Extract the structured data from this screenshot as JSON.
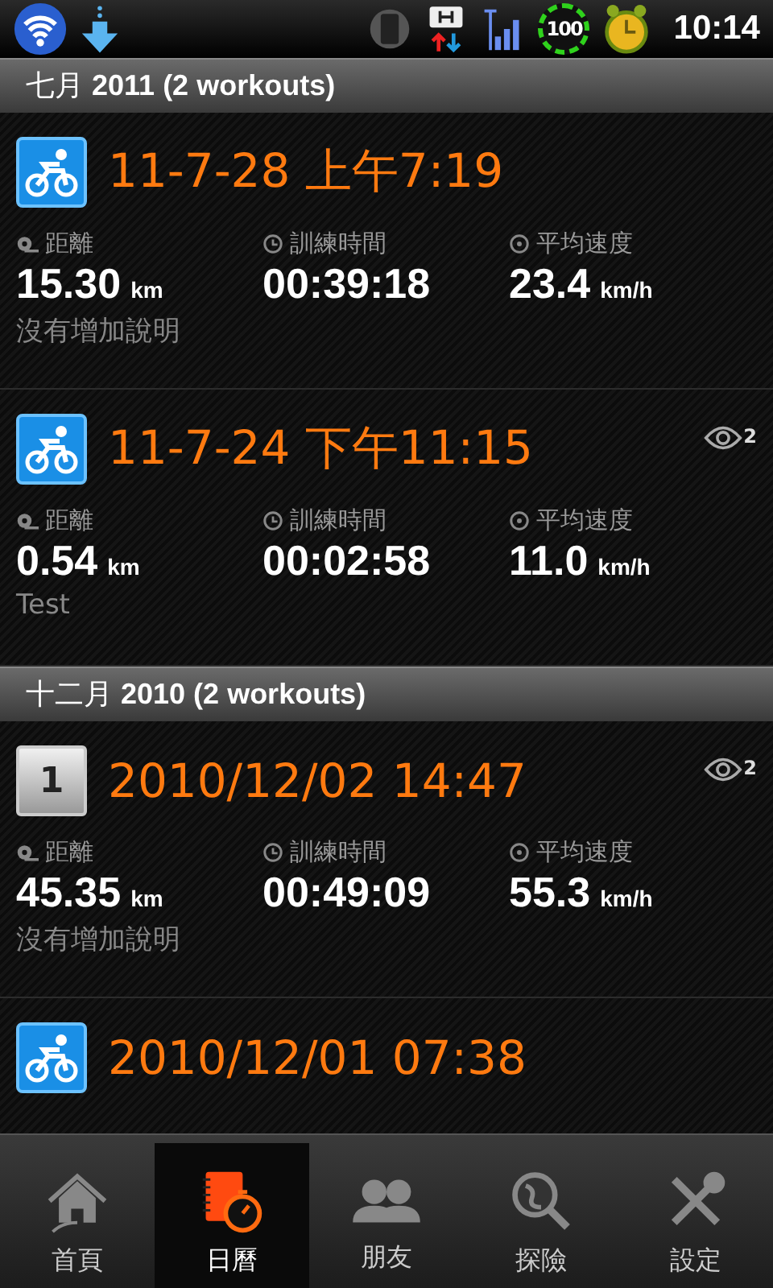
{
  "status_bar": {
    "time": "10:14",
    "battery": "100"
  },
  "sections": [
    {
      "title": "七月",
      "year": "2011 (2 workouts)",
      "workouts": [
        {
          "kind": "cycling",
          "title": "11-7-28 上午7:19",
          "stats": [
            {
              "kind": "distance",
              "label": "距離",
              "value": "15.30",
              "unit": "km"
            },
            {
              "kind": "duration",
              "label": "訓練時間",
              "value": "00:39:18"
            },
            {
              "kind": "speed",
              "label": "平均速度",
              "value": "23.4",
              "unit": "km/h"
            }
          ],
          "note": "沒有增加說明"
        },
        {
          "kind": "cycling",
          "title": "11-7-24 下午11:15",
          "views": "2",
          "stats": [
            {
              "kind": "distance",
              "label": "距離",
              "value": "0.54",
              "unit": "km"
            },
            {
              "kind": "duration",
              "label": "訓練時間",
              "value": "00:02:58"
            },
            {
              "kind": "speed",
              "label": "平均速度",
              "value": "11.0",
              "unit": "km/h"
            }
          ],
          "note": "Test"
        }
      ]
    },
    {
      "title": "十二月",
      "year": "2010 (2 workouts)",
      "workouts": [
        {
          "kind": "manual",
          "badge": "1",
          "title": "2010/12/02 14:47",
          "views": "2",
          "stats": [
            {
              "kind": "distance",
              "label": "距離",
              "value": "45.35",
              "unit": "km"
            },
            {
              "kind": "duration",
              "label": "訓練時間",
              "value": "00:49:09"
            },
            {
              "kind": "speed",
              "label": "平均速度",
              "value": "55.3",
              "unit": "km/h"
            }
          ],
          "note": "沒有增加說明"
        },
        {
          "kind": "cycling",
          "title": "2010/12/01 07:38"
        }
      ]
    }
  ],
  "tabs": [
    {
      "kind": "home",
      "label": "首頁",
      "selected": false
    },
    {
      "kind": "calendar",
      "label": "日曆",
      "selected": true
    },
    {
      "kind": "friends",
      "label": "朋友",
      "selected": false
    },
    {
      "kind": "explore",
      "label": "探險",
      "selected": false
    },
    {
      "kind": "settings",
      "label": "設定",
      "selected": false
    }
  ]
}
